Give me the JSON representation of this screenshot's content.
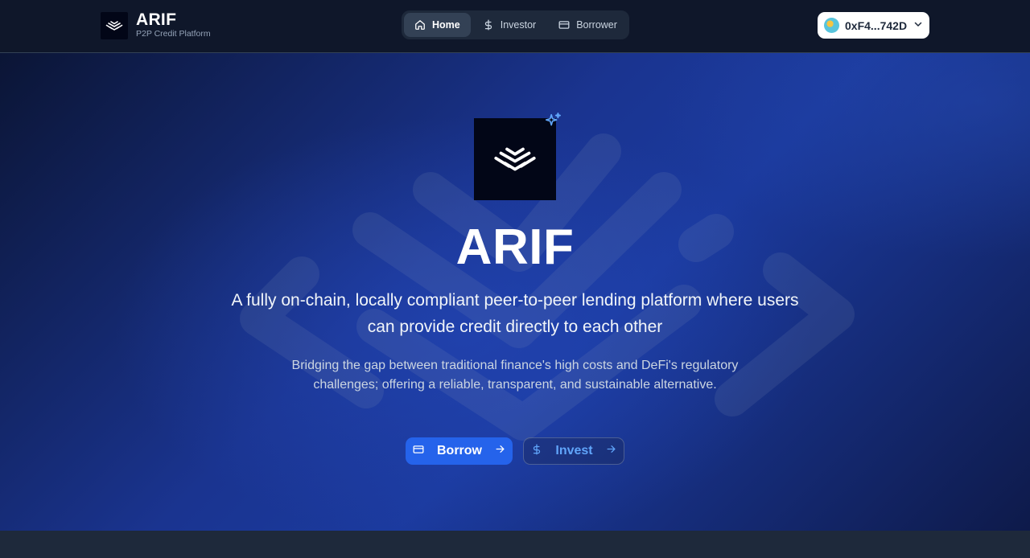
{
  "brand": {
    "name": "ARIF",
    "tagline": "P2P Credit Platform"
  },
  "nav": {
    "tabs": [
      {
        "label": "Home",
        "icon": "home-icon",
        "active": true
      },
      {
        "label": "Investor",
        "icon": "dollar-icon",
        "active": false
      },
      {
        "label": "Borrower",
        "icon": "credit-card-icon",
        "active": false
      }
    ]
  },
  "wallet": {
    "address": "0xF4...742D",
    "icon": "chevron-down-icon"
  },
  "hero": {
    "title": "ARIF",
    "lead": "A fully on-chain, locally compliant peer-to-peer lending platform where users can provide credit directly to each other",
    "sub": "Bridging the gap between traditional finance's high costs and DeFi's regulatory challenges; offering a reliable, transparent, and sustainable alternative.",
    "borrow_label": "Borrow",
    "invest_label": "Invest"
  },
  "colors": {
    "header_bg": "#0f172a",
    "accent": "#2563eb",
    "invest_text": "#60a5fa",
    "sparkle": "#60a5fa"
  }
}
